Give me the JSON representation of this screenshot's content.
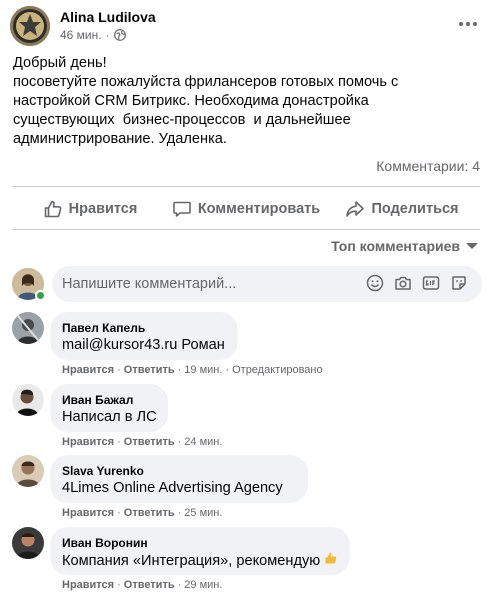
{
  "post": {
    "author": "Alina Ludilova",
    "time": "46 мин.",
    "meta_dot": "·",
    "body_lines": [
      "Добрый день!",
      "посоветуйте пожалуйста фрилансеров готовых помочь с",
      "настройкой CRM Битрикс. Необходима донастройка",
      "существующих  бизнес-процессов  и дальнейшее",
      "администрирование. Удаленка."
    ],
    "comments_count": "Комментарии: 4"
  },
  "actions": {
    "like": "Нравится",
    "comment": "Комментировать",
    "share": "Поделиться"
  },
  "sort": {
    "label": "Топ комментариев"
  },
  "composer": {
    "placeholder": "Напишите комментарий..."
  },
  "comments": [
    {
      "author": "Павел Капель",
      "text": "mail@kursor43.ru Роман",
      "like": "Нравится",
      "reply": "Ответить",
      "time": "19 мин.",
      "extra": "Отредактировано"
    },
    {
      "author": "Иван Бажал",
      "text": "Написал в ЛС",
      "like": "Нравится",
      "reply": "Ответить",
      "time": "24 мин."
    },
    {
      "author": "Slava Yurenko",
      "text": "4Limes Online Advertising Agency",
      "like": "Нравится",
      "reply": "Ответить",
      "time": "25 мин."
    },
    {
      "author": "Иван Воронин",
      "text": "Компания «Интеграция», рекомендую",
      "like": "Нравится",
      "reply": "Ответить",
      "time": "29 мин."
    }
  ],
  "separators": {
    "dot": "·"
  },
  "icons": [
    "globe-icon",
    "more-icon",
    "thumbs-up-icon",
    "comment-icon",
    "share-icon",
    "smiley-icon",
    "camera-icon",
    "gif-icon",
    "sticker-icon",
    "thumbs-up-emoji-icon"
  ],
  "colors": {
    "secondary_text": "#65676b",
    "bubble_bg": "#f0f2f5",
    "online": "#31a24c",
    "divider": "#ced0d4"
  }
}
